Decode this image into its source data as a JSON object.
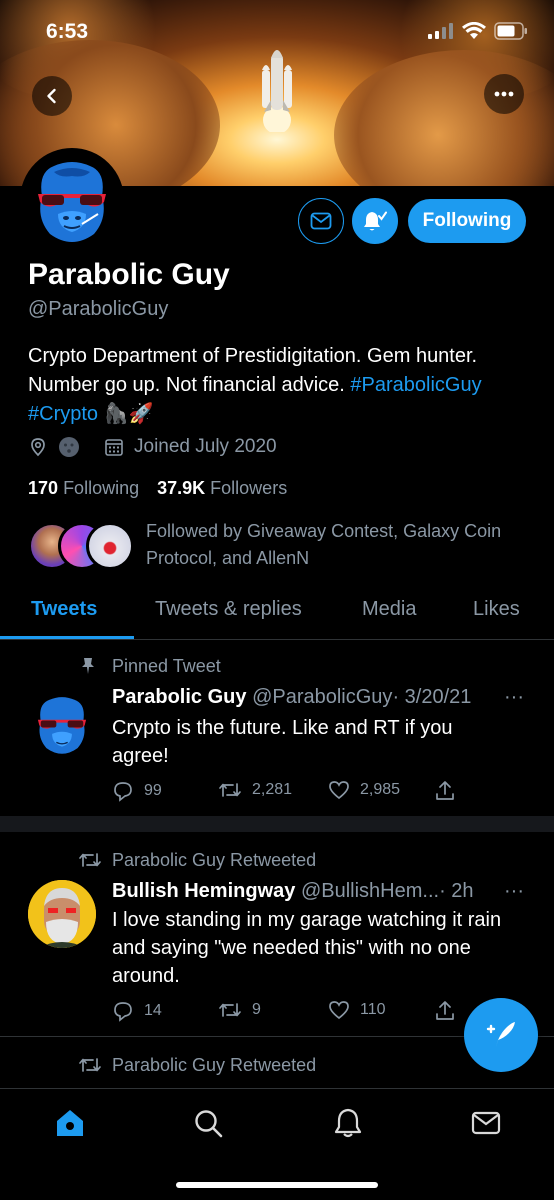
{
  "status_bar": {
    "time": "6:53"
  },
  "profile": {
    "name": "Parabolic Guy",
    "handle": "@ParabolicGuy",
    "bio_text": "Crypto Department of Prestidigitation. Gem hunter. Number go up. Not financial advice. ",
    "bio_hashtag_1": "#ParabolicGuy",
    "bio_hashtag_2": "#Crypto",
    "bio_emoji": "🦍🚀",
    "joined": "Joined July 2020",
    "following_count": "170",
    "following_label": "Following",
    "followers_count": "37.9K",
    "followers_label": "Followers",
    "followed_by": "Followed by Giveaway Contest, Galaxy Coin Protocol, and AllenN",
    "follow_button": "Following"
  },
  "tabs": [
    {
      "label": "Tweets",
      "active": true
    },
    {
      "label": "Tweets & replies",
      "active": false
    },
    {
      "label": "Media",
      "active": false
    },
    {
      "label": "Likes",
      "active": false
    }
  ],
  "tweets": [
    {
      "context": "Pinned Tweet",
      "author_name": "Parabolic Guy",
      "author_handle": "@ParabolicGuy",
      "date": "· 3/20/21",
      "text": "Crypto is the future. Like and RT if you agree!",
      "replies": "99",
      "retweets": "2,281",
      "likes": "2,985"
    },
    {
      "context": "Parabolic Guy Retweeted",
      "author_name": "Bullish Hemingway",
      "author_handle": "@BullishHem...",
      "date": "· 2h",
      "text": "I love standing in my garage watching it rain and saying \"we needed this\" with no one around.",
      "replies": "14",
      "retweets": "9",
      "likes": "110"
    },
    {
      "context": "Parabolic Guy Retweeted"
    }
  ],
  "more_dots": "···",
  "colors": {
    "accent": "#1d9bf0",
    "muted": "#8b98a5",
    "background": "#000000"
  },
  "icons": {
    "back": "chevron-left-icon",
    "more": "more-horizontal-icon",
    "mail": "mail-icon",
    "bell": "bell-icon",
    "location": "location-pin-icon",
    "calendar": "calendar-icon",
    "pin": "pin-icon",
    "retweet": "retweet-icon",
    "reply": "reply-icon",
    "like": "heart-icon",
    "share": "share-icon",
    "compose": "compose-icon",
    "home": "home-icon",
    "search": "search-icon",
    "notifications": "bell-icon",
    "messages": "mail-icon"
  }
}
